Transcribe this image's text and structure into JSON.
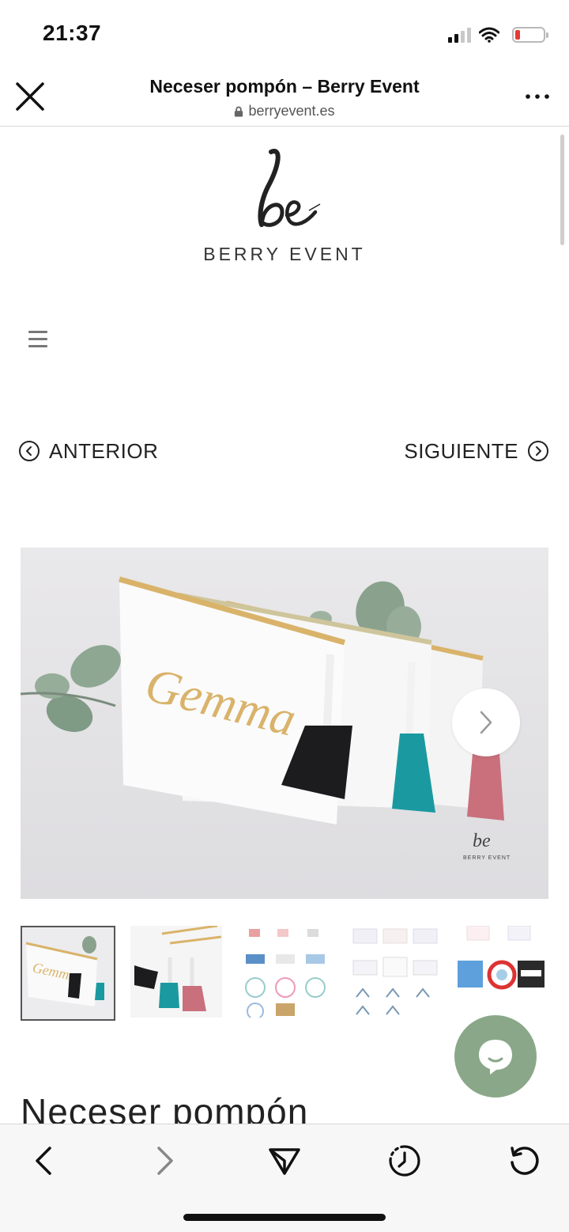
{
  "status_bar": {
    "time": "21:37",
    "battery_level": 0.18,
    "battery_color": "#e53935",
    "signal_bars": 2
  },
  "browser": {
    "title": "Neceser pompón – Berry Event",
    "url": "berryevent.es",
    "close_icon": "close-icon",
    "more_icon": "more-icon",
    "lock_icon": "lock-icon"
  },
  "logo": {
    "mark": "be",
    "name": "BERRY  EVENT"
  },
  "nav": {
    "prev_label": "ANTERIOR",
    "next_label": "SIGUIENTE"
  },
  "product": {
    "image_name": "Gemma",
    "watermark": "be",
    "watermark_sub": "BERRY EVENT",
    "title": "Neceser pompón",
    "tassel_colors": [
      "#1c1c1f",
      "#1a9aa0",
      "#c9707c"
    ],
    "accent_gold": "#d9b36a"
  },
  "thumbnails": [
    {
      "name": "thumb-gemma-bags",
      "active": true
    },
    {
      "name": "thumb-tassels",
      "active": false
    },
    {
      "name": "thumb-name-designs-1",
      "active": false
    },
    {
      "name": "thumb-name-designs-2",
      "active": false
    },
    {
      "name": "thumb-name-designs-3",
      "active": false
    }
  ],
  "chat": {
    "color": "#8aa889",
    "icon": "chat-icon"
  },
  "toolbar": {
    "items": [
      "back-icon",
      "forward-icon",
      "share-icon",
      "history-icon",
      "reload-icon"
    ]
  }
}
